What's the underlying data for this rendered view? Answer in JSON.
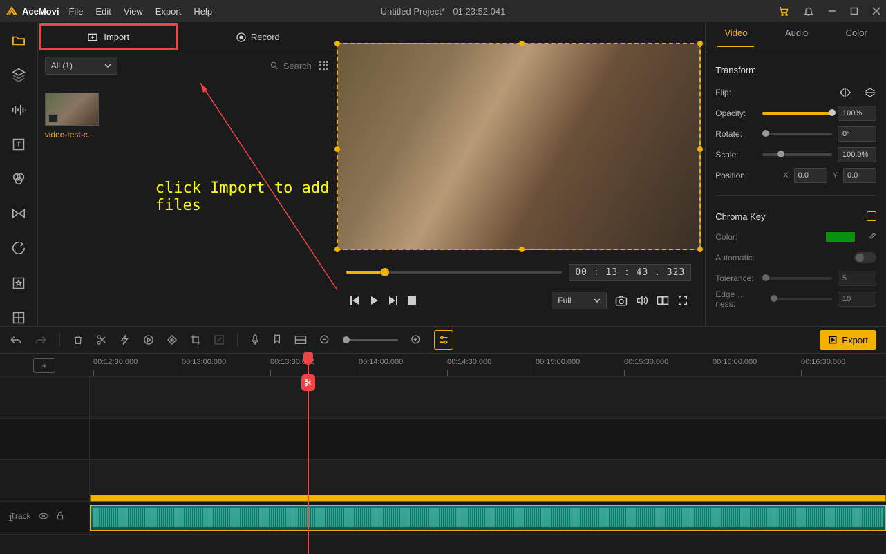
{
  "app": {
    "name": "AceMovi",
    "title": "Untitled Project* - 01:23:52.041"
  },
  "menu": {
    "file": "File",
    "edit": "Edit",
    "view": "View",
    "export": "Export",
    "help": "Help"
  },
  "tabs": {
    "import": "Import",
    "record": "Record"
  },
  "media": {
    "filter": "All (1)",
    "search_ph": "Search",
    "thumb_label": "video-test-c..."
  },
  "hint": "click Import to add files",
  "preview": {
    "time": "00 : 13 : 43 . 323",
    "quality": "Full"
  },
  "props": {
    "tab_video": "Video",
    "tab_audio": "Audio",
    "tab_color": "Color",
    "transform": "Transform",
    "flip": "Flip:",
    "opacity": "Opacity:",
    "opacity_val": "100%",
    "rotate": "Rotate:",
    "rotate_val": "0°",
    "scale": "Scale:",
    "scale_val": "100.0%",
    "position": "Position:",
    "pos_x": "0.0",
    "pos_y": "0.0",
    "chroma": "Chroma Key",
    "color": "Color:",
    "auto": "Automatic:",
    "tolerance": "Tolerance:",
    "tolerance_val": "5",
    "edge": "Edge …ness:",
    "edge_val": "10"
  },
  "export_btn": "Export",
  "timeline": {
    "ticks": [
      "00:12:30.000",
      "00:13:00.000",
      "00:13:30.000",
      "00:14:00.000",
      "00:14:30.000",
      "00:15:00.000",
      "00:15:30.000",
      "00:16:00.000",
      "00:16:30.000"
    ],
    "track_label": "Track",
    "track_num": "1"
  }
}
